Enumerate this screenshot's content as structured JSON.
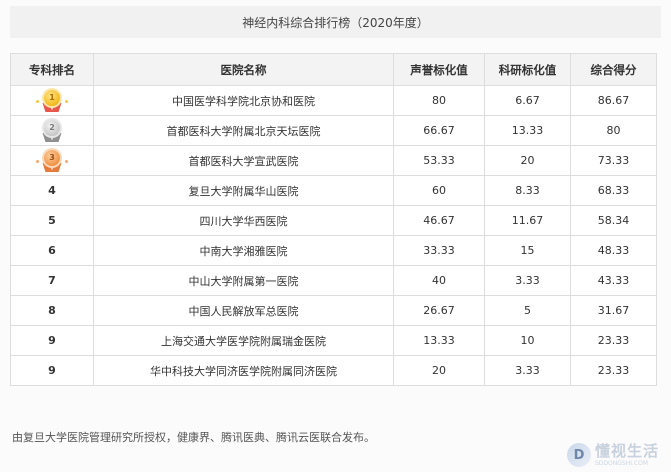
{
  "title": "神经内科综合排行榜（2020年度）",
  "table": {
    "headers": [
      "专科排名",
      "医院名称",
      "声誉标化值",
      "科研标化值",
      "综合得分"
    ],
    "rows": [
      {
        "rank": "1",
        "medal": "gold",
        "hospital": "中国医学科学院北京协和医院",
        "reputation": "80",
        "research": "6.67",
        "total": "86.67"
      },
      {
        "rank": "2",
        "medal": "silver",
        "hospital": "首都医科大学附属北京天坛医院",
        "reputation": "66.67",
        "research": "13.33",
        "total": "80"
      },
      {
        "rank": "3",
        "medal": "bronze",
        "hospital": "首都医科大学宣武医院",
        "reputation": "53.33",
        "research": "20",
        "total": "73.33"
      },
      {
        "rank": "4",
        "medal": "",
        "hospital": "复旦大学附属华山医院",
        "reputation": "60",
        "research": "8.33",
        "total": "68.33"
      },
      {
        "rank": "5",
        "medal": "",
        "hospital": "四川大学华西医院",
        "reputation": "46.67",
        "research": "11.67",
        "total": "58.34"
      },
      {
        "rank": "6",
        "medal": "",
        "hospital": "中南大学湘雅医院",
        "reputation": "33.33",
        "research": "15",
        "total": "48.33"
      },
      {
        "rank": "7",
        "medal": "",
        "hospital": "中山大学附属第一医院",
        "reputation": "40",
        "research": "3.33",
        "total": "43.33"
      },
      {
        "rank": "8",
        "medal": "",
        "hospital": "中国人民解放军总医院",
        "reputation": "26.67",
        "research": "5",
        "total": "31.67"
      },
      {
        "rank": "9",
        "medal": "",
        "hospital": "上海交通大学医学院附属瑞金医院",
        "reputation": "13.33",
        "research": "10",
        "total": "23.33"
      },
      {
        "rank": "9",
        "medal": "",
        "hospital": "华中科技大学同济医学院附属同济医院",
        "reputation": "20",
        "research": "3.33",
        "total": "23.33"
      }
    ]
  },
  "footer": "由复旦大学医院管理研究所授权，健康界、腾讯医典、腾讯云医联合发布。",
  "watermark": {
    "main": "懂视生活",
    "sub": "SDDONGSHI.COM",
    "logo_glyph": "D",
    "icon": "d-logo-icon"
  },
  "colors": {
    "gold": "#f2b81c",
    "silver": "#c7c7c7",
    "bronze": "#ef9347",
    "header_bg": "#f3f3f3",
    "border": "#dddddd"
  }
}
